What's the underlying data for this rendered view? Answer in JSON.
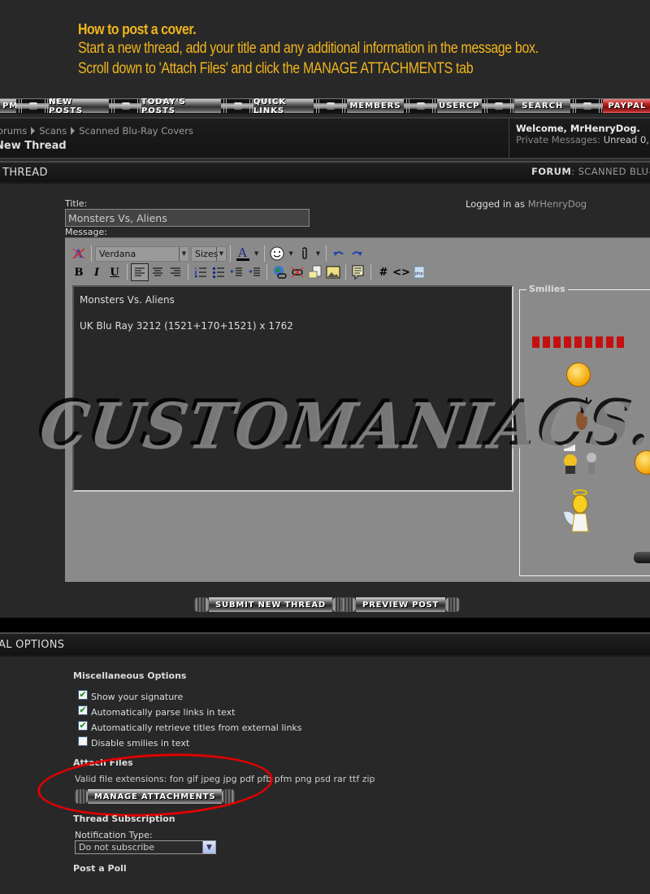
{
  "instructions": {
    "heading": "How to post a cover.",
    "lines": [
      "Start a new thread, add your title and any additional information in the message box.",
      "Scroll down to 'Attach Files' and click the MANAGE ATTACHMENTS tab"
    ]
  },
  "nav": {
    "items": [
      "PM",
      "NEW POSTS",
      "TODAY'S POSTS",
      "QUICK LINKS",
      "MEMBERS",
      "USERCP",
      "SEARCH",
      "PAYPAL"
    ],
    "accent_item_color": "#b22222"
  },
  "breadcrumb": {
    "items": [
      "orums",
      "Scans",
      "Scanned Blu-Ray Covers"
    ],
    "page_title": "New Thread"
  },
  "welcome": {
    "greeting": "Welcome, MrHenryDog.",
    "pm_label": "Private Messages:",
    "pm_value": "Unread 0,"
  },
  "thread_section": {
    "title": "/ THREAD",
    "forum_label": "FORUM",
    "forum_value": ": SCANNED BLU-R"
  },
  "form": {
    "title_label": "Title:",
    "title_value": "Monsters Vs, Aliens",
    "message_label": "Message:",
    "logged_in_prefix": "Logged in as",
    "logged_in_user": "MrHenryDog"
  },
  "editor": {
    "font_select": "Verdana",
    "size_select": "Sizes",
    "toolbar_row1": [
      "remove-format",
      "font",
      "size",
      "text-color",
      "smilie",
      "attachment",
      "undo",
      "redo"
    ],
    "toolbar_row2": [
      "bold",
      "italic",
      "underline",
      "align-left",
      "align-center",
      "align-right",
      "ordered-list",
      "unordered-list",
      "outdent",
      "indent",
      "insert-link",
      "remove-link",
      "email-link",
      "insert-image",
      "quote",
      "code-hash",
      "html-code",
      "php-code"
    ],
    "message_lines": [
      "Monsters Vs. Aliens",
      "UK Blu Ray  3212 (1521+170+1521) x 1762"
    ],
    "smilies_legend": "Smilies"
  },
  "watermark": "CUSTOMANIACS.ORG",
  "buttons": {
    "submit": "SUBMIT NEW THREAD",
    "preview": "PREVIEW POST",
    "manage_attachments": "MANAGE ATTACHMENTS"
  },
  "options_section": {
    "title": "AL OPTIONS"
  },
  "misc_options": {
    "heading": "Miscellaneous Options",
    "checkboxes": [
      {
        "label": "Show your signature",
        "checked": true
      },
      {
        "label": "Automatically parse links in text",
        "checked": true
      },
      {
        "label": "Automatically retrieve titles from external links",
        "checked": true
      },
      {
        "label": "Disable smilies in text",
        "checked": false
      }
    ]
  },
  "attach": {
    "heading": "Attach Files",
    "extensions": "Valid file extensions: fon gif jpeg jpg pdf pfb pfm png psd rar ttf zip",
    "highlight_color": "#e00000"
  },
  "subscription": {
    "heading": "Thread Subscription",
    "notification_label": "Notification Type:",
    "notification_value": "Do not subscribe"
  },
  "poll": {
    "heading": "Post a Poll"
  }
}
